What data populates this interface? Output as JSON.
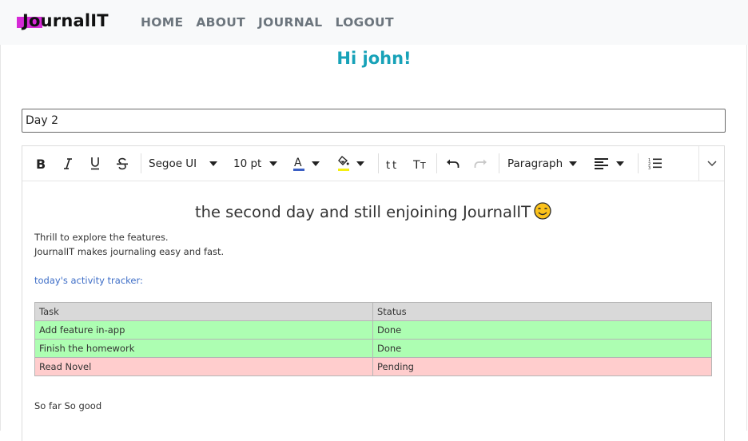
{
  "app": {
    "logo_text": "JournalIT",
    "nav": [
      "HOME",
      "ABOUT",
      "JOURNAL",
      "LOGOUT"
    ],
    "greeting": "Hi john!"
  },
  "entry": {
    "title_value": "Day 2"
  },
  "toolbar": {
    "font_family": "Segoe UI",
    "font_size": "10 pt",
    "block_format": "Paragraph",
    "buttons": [
      "bold",
      "italic",
      "underline",
      "strikethrough",
      "font-family",
      "font-size",
      "font-color",
      "highlight",
      "superscript",
      "subscript",
      "undo",
      "redo",
      "block-format",
      "align",
      "numbered-list",
      "more"
    ]
  },
  "content": {
    "heading": "the second day and still enjoining JournalIT",
    "line1": "Thrill to explore the features.",
    "line2": "JournalIT makes journaling easy and fast.",
    "tracker_label": "today's activity tracker:",
    "table": {
      "headers": [
        "Task",
        "Status"
      ],
      "rows": [
        {
          "task": "Add  feature in-app",
          "status": "Done",
          "color": "#adfeb2"
        },
        {
          "task": "Finish the homework",
          "status": "Done",
          "color": "#adfeb2"
        },
        {
          "task": "Read Novel",
          "status": "Pending",
          "color": "#ffcdcd"
        }
      ]
    },
    "footer_text": "So far So good"
  },
  "colors": {
    "accent": "#17a2b8",
    "logo_highlight": "#d62ad6",
    "font_color_swatch": "#3b5fc4",
    "highlight_swatch": "#f5ef11"
  }
}
